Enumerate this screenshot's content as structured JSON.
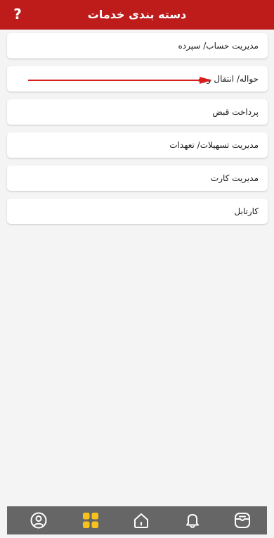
{
  "header": {
    "title": "دسته بندی خدمات",
    "help_icon": "?",
    "color": "#be1b1b"
  },
  "menu": {
    "items": [
      {
        "label": "مدیریت حساب/ سپرده"
      },
      {
        "label": "حواله/ انتقال وجه"
      },
      {
        "label": "پرداخت قبض"
      },
      {
        "label": "مدیریت تسهیلات/ تعهدات"
      },
      {
        "label": "مدیریت کارت"
      },
      {
        "label": "کارتابل"
      }
    ]
  },
  "annotation": {
    "arrow_color": "#d91e1e",
    "points_to": "حواله/ انتقال وجه"
  },
  "bottom_nav": {
    "items": [
      {
        "icon": "profile-icon",
        "active": false
      },
      {
        "icon": "grid-icon",
        "active": true
      },
      {
        "icon": "home-icon",
        "active": false
      },
      {
        "icon": "bell-icon",
        "active": false
      },
      {
        "icon": "wallet-icon",
        "active": false
      }
    ],
    "active_color": "#f6c21b",
    "inactive_color": "#ffffff"
  }
}
